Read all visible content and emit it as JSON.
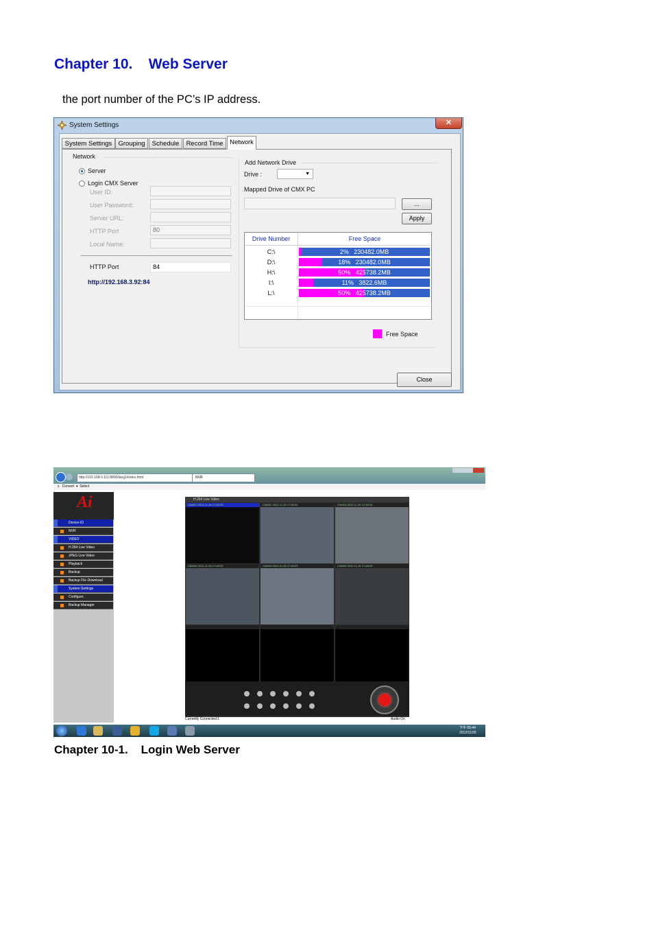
{
  "chapter": {
    "title": "Chapter 10.    Web Server"
  },
  "body_text": "the port number of the PC’s IP address.",
  "dialog": {
    "title": "System Settings",
    "close_x": "✕",
    "tabs": [
      "System Settings",
      "Grouping",
      "Schedule",
      "Record Time",
      "Network"
    ],
    "network_group": "Network",
    "radio_server": "Server",
    "radio_login": "Login CMX Server",
    "fields": [
      {
        "label": "User ID:",
        "value": ""
      },
      {
        "label": "User Password:",
        "value": ""
      },
      {
        "label": "Server URL:",
        "value": ""
      },
      {
        "label": "HTTP Port",
        "value": "80"
      },
      {
        "label": "Local Name:",
        "value": ""
      }
    ],
    "http_port_label": "HTTP Port",
    "http_port_value": "84",
    "url_text": "http://192.168.3.92:84",
    "add_drive_group": "Add Network Drive",
    "drive_label": "Drive :",
    "mapped_label": "Mapped Drive of CMX PC",
    "browse_button": "...",
    "apply_button": "Apply",
    "col_drive": "Drive Number",
    "col_free": "Free Space",
    "drives": [
      {
        "drive": "C:\\",
        "percent": 2,
        "text": "2%   230482.0MB"
      },
      {
        "drive": "D:\\",
        "percent": 18,
        "text": "18%   230482.0MB"
      },
      {
        "drive": "H:\\",
        "percent": 50,
        "text": "50%   425738.2MB"
      },
      {
        "drive": "I:\\",
        "percent": 11,
        "text": "11%   3822.6MB"
      },
      {
        "drive": "L:\\",
        "percent": 50,
        "text": "50%   425738.2MB"
      }
    ],
    "legend_label": "Free Space",
    "legend_color": "#ff00ff",
    "bar_color": "#3262c8",
    "close_button": "Close"
  },
  "screenshot2": {
    "url": "http://192.168.0.111:8800/lang1/index.html",
    "tab_label": "NVR",
    "menu_text": "x   Convert  ▾  Select",
    "sidebar_items": [
      {
        "label": "Device-ID",
        "kind": "h"
      },
      {
        "label": "NVR",
        "kind": "n"
      },
      {
        "label": "VIDEO",
        "kind": "h"
      },
      {
        "label": "H.264 Live Video",
        "kind": "n"
      },
      {
        "label": "JPEG Live Video",
        "kind": "n"
      },
      {
        "label": "Playback",
        "kind": "n"
      },
      {
        "label": "Backup",
        "kind": "n"
      },
      {
        "label": "Backup File Download",
        "kind": "n"
      },
      {
        "label": "System Settings",
        "kind": "h"
      },
      {
        "label": "Configure",
        "kind": "n"
      },
      {
        "label": "Backup Manager",
        "kind": "n"
      }
    ],
    "viewer_title": "H.264 Live Video",
    "cams": [
      "CAM01 2012-11-26 17:48:33",
      "CAM02 2012-11-26 17:48:33",
      "CAM03 2012-11-26 17:48:33",
      "CAM04 2012-11-26 17:48:33",
      "CAM05 2012-11-26 17:48:33",
      "CAM06 2012-11-26 17:48:33",
      "",
      "",
      ""
    ],
    "status": "Currently Connected:1",
    "audio": "Audio On",
    "clock": "下午 05:44\n2012/11/26"
  },
  "caption": "Chapter 10-1.    Login Web Server"
}
